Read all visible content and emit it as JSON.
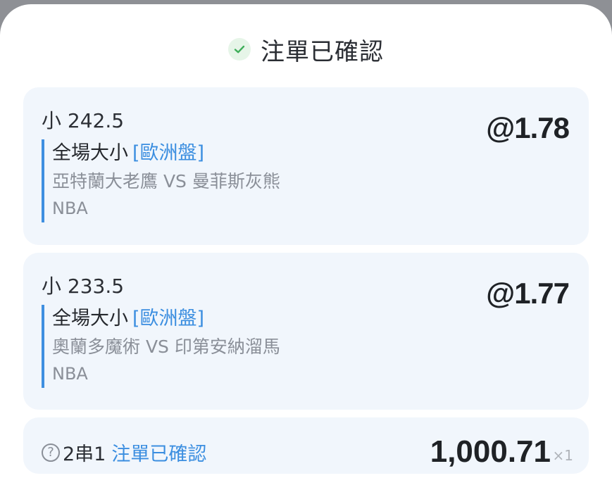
{
  "header": {
    "icon": "check-circle-icon",
    "title": "注單已確認",
    "accent_color": "#3fae5a"
  },
  "bets": [
    {
      "selection": "小 242.5",
      "odds": "@1.78",
      "market": "全場大小",
      "market_tag": "[歐洲盤]",
      "matchup": "亞特蘭大老鷹 VS 曼菲斯灰熊",
      "league": "NBA"
    },
    {
      "selection": "小 233.5",
      "odds": "@1.77",
      "market": "全場大小",
      "market_tag": "[歐洲盤]",
      "matchup": "奧蘭多魔術 VS 印第安納溜馬",
      "league": "NBA"
    }
  ],
  "parlay": {
    "icon": "question-circle-icon",
    "type": "2串1",
    "status": "注單已確認",
    "amount": "1,000.71",
    "amount_suffix": "×1"
  },
  "colors": {
    "card_bg": "#f1f6fc",
    "link_blue": "#3b8ee0",
    "muted_text": "#8a8f98"
  }
}
